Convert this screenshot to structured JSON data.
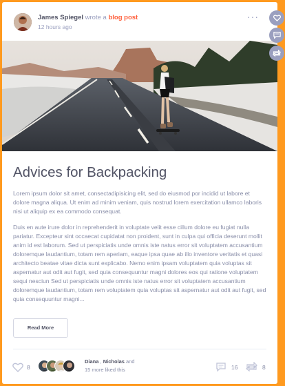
{
  "post": {
    "author": "James Spiegel",
    "action": "wrote a",
    "link_text": "blog post",
    "time": "12 hours ago",
    "more": "···",
    "title": "Advices for Backpacking",
    "paragraph1": "Lorem ipsum dolor sit amet, consectadipisicing elit, sed do eiusmod por incidid ut labore et dolore magna aliqua. Ut enim ad minim veniam, quis nostrud lorem exercitation ullamco laboris nisi ut aliquip ex ea commodo consequat.",
    "paragraph2": "Duis en aute irure dolor in reprehenderit in voluptate velit esse cillum dolore eu fugiat nulla pariatur. Excepteur sint occaecat cupidatat non proident, sunt in culpa qui officia deserunt mollit anim id est laborum. Sed ut perspiciatis unde omnis iste natus error sit voluptatem accusantium doloremque laudantium, totam rem aperiam, eaque ipsa quae ab illo inventore veritatis et quasi architecto beatae vitae dicta sunt explicabo. Nemo enim ipsam voluptatem quia voluptas sit aspernatur aut odit aut fugit, sed quia consequuntur magni dolores eos qui ratione voluptatem sequi nesciun Sed ut perspiciatis unde omnis iste natus error sit voluptatem accusantium doloremque laudantium, totam rem voluptatem quia voluptas sit aspernatur aut odit aut fugit, sed quia consequuntur magni...",
    "read_more": "Read More"
  },
  "footer": {
    "like_count": "8",
    "liked_by_1": "Diana",
    "liked_sep": " , ",
    "liked_by_2": "Nicholas",
    "liked_and": " and",
    "liked_more": "15 more liked this",
    "comment_count": "16",
    "share_count": "8"
  },
  "icons": {
    "like": "heart-icon",
    "comment": "speech-bubble-icon",
    "share": "share-arrows-icon"
  },
  "colors": {
    "accent": "#ff5e3a",
    "page_bg": "#ff9a1f",
    "text_dark": "#515365",
    "text_muted": "#888da8",
    "side_button": "#9a9fbf"
  }
}
